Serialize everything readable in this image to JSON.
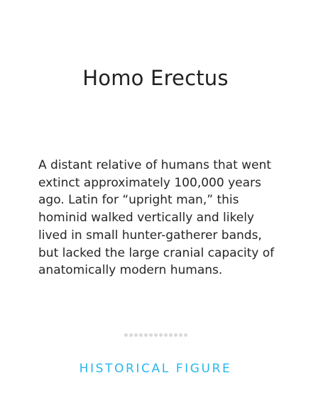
{
  "card": {
    "title": "Homo Erectus",
    "description": "A distant relative of humans that went extinct approximately 100,000 years ago. Latin for “upright man,” this hominid walked vertically and likely lived in small hunter-gatherer bands, but lacked the large cranial capacity of anatomically modern humans.",
    "category": "HISTORICAL FIGURE",
    "pagination": {
      "total_pages": 13
    }
  },
  "colors": {
    "accent": "#29b6f0",
    "text": "#222222",
    "dot": "#d9d9d9",
    "background": "#ffffff"
  }
}
